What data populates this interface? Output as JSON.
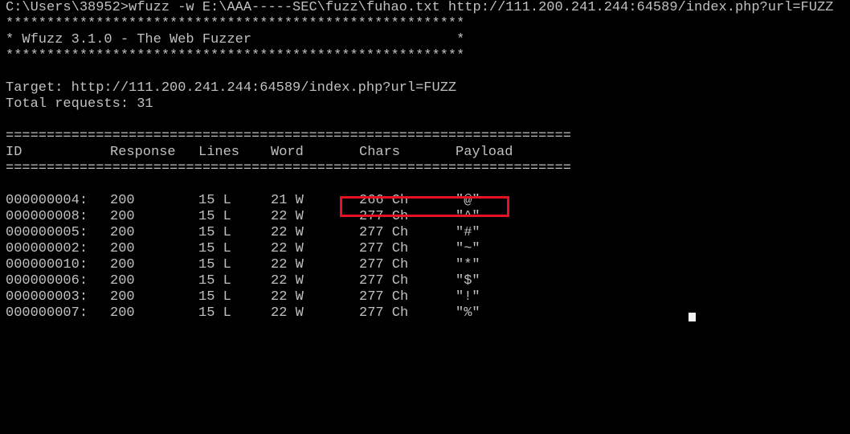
{
  "terminal": {
    "command_line": "C:\\Users\\38952>wfuzz -w E:\\AAA-----SEC\\fuzz\\fuhao.txt http://111.200.241.244:64589/index.php?url=FUZZ",
    "banner": [
      "********************************************************",
      "* Wfuzz 3.1.0 - The Web Fuzzer                         *",
      "********************************************************"
    ],
    "target_line": "Target: http://111.200.241.244:64589/index.php?url=FUZZ",
    "total_line": "Total requests: 31",
    "rule": "=====================================================================",
    "headers": {
      "id": "ID",
      "response": "Response",
      "lines": "Lines",
      "word": "Word",
      "chars": "Chars",
      "payload": "Payload"
    },
    "rows": [
      {
        "id": "000000004:",
        "response": "200",
        "lines": "15 L",
        "word": "21 W",
        "chars": "266 Ch",
        "payload": "\"@\""
      },
      {
        "id": "000000008:",
        "response": "200",
        "lines": "15 L",
        "word": "22 W",
        "chars": "277 Ch",
        "payload": "\"^\""
      },
      {
        "id": "000000005:",
        "response": "200",
        "lines": "15 L",
        "word": "22 W",
        "chars": "277 Ch",
        "payload": "\"#\""
      },
      {
        "id": "000000002:",
        "response": "200",
        "lines": "15 L",
        "word": "22 W",
        "chars": "277 Ch",
        "payload": "\"~\""
      },
      {
        "id": "000000010:",
        "response": "200",
        "lines": "15 L",
        "word": "22 W",
        "chars": "277 Ch",
        "payload": "\"*\""
      },
      {
        "id": "000000006:",
        "response": "200",
        "lines": "15 L",
        "word": "22 W",
        "chars": "277 Ch",
        "payload": "\"$\""
      },
      {
        "id": "000000003:",
        "response": "200",
        "lines": "15 L",
        "word": "22 W",
        "chars": "277 Ch",
        "payload": "\"!\""
      },
      {
        "id": "000000007:",
        "response": "200",
        "lines": "15 L",
        "word": "22 W",
        "chars": "277 Ch",
        "payload": "\"%\""
      }
    ]
  },
  "colors": {
    "background": "#000000",
    "text": "#c0c0c0",
    "highlight_border": "#e81123",
    "cursor": "#f2f2f2"
  }
}
